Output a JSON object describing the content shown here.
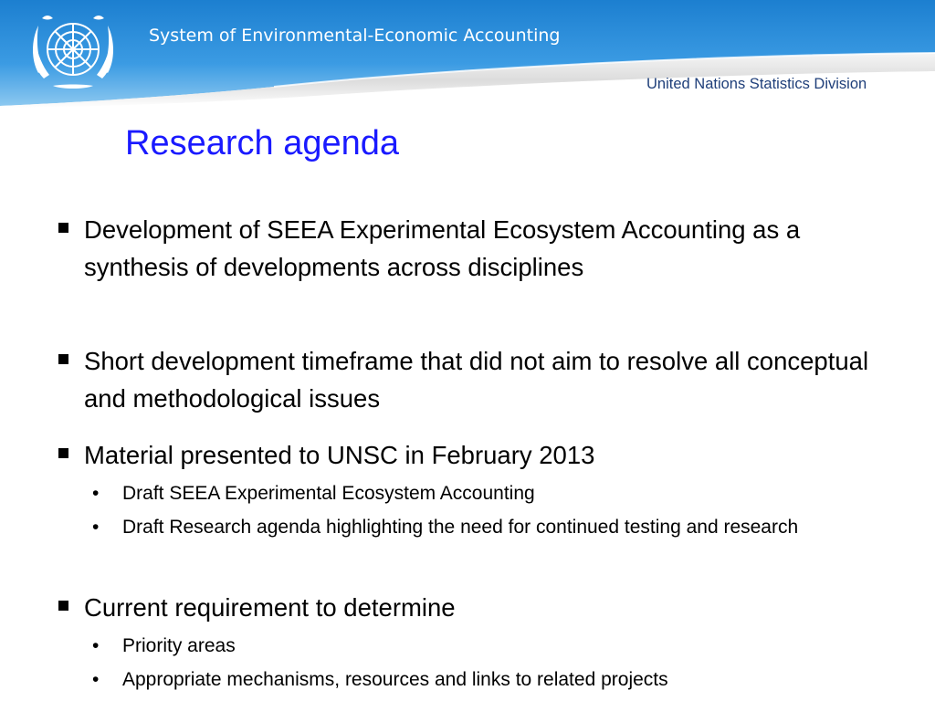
{
  "header": {
    "title": "System of Environmental-Economic Accounting",
    "organization": "United Nations Statistics Division",
    "logo_icon": "un-emblem-icon"
  },
  "slide": {
    "title": "Research agenda",
    "bullets": [
      {
        "text": "Development of SEEA Experimental Ecosystem Accounting as a synthesis of developments across disciplines"
      },
      {
        "text": "Short development timeframe that did not aim to resolve all conceptual and methodological issues"
      },
      {
        "text": "Material presented to UNSC in February 2013",
        "sub": [
          "Draft SEEA Experimental Ecosystem Accounting",
          "Draft Research agenda highlighting the need for continued testing and research"
        ]
      },
      {
        "text": "Current requirement to determine",
        "sub": [
          "Priority areas",
          "Appropriate mechanisms, resources and links to related projects"
        ]
      }
    ]
  },
  "colors": {
    "header_blue": "#2f8fd8",
    "title_blue": "#1a1aff",
    "org_text": "#1f3f7a"
  }
}
